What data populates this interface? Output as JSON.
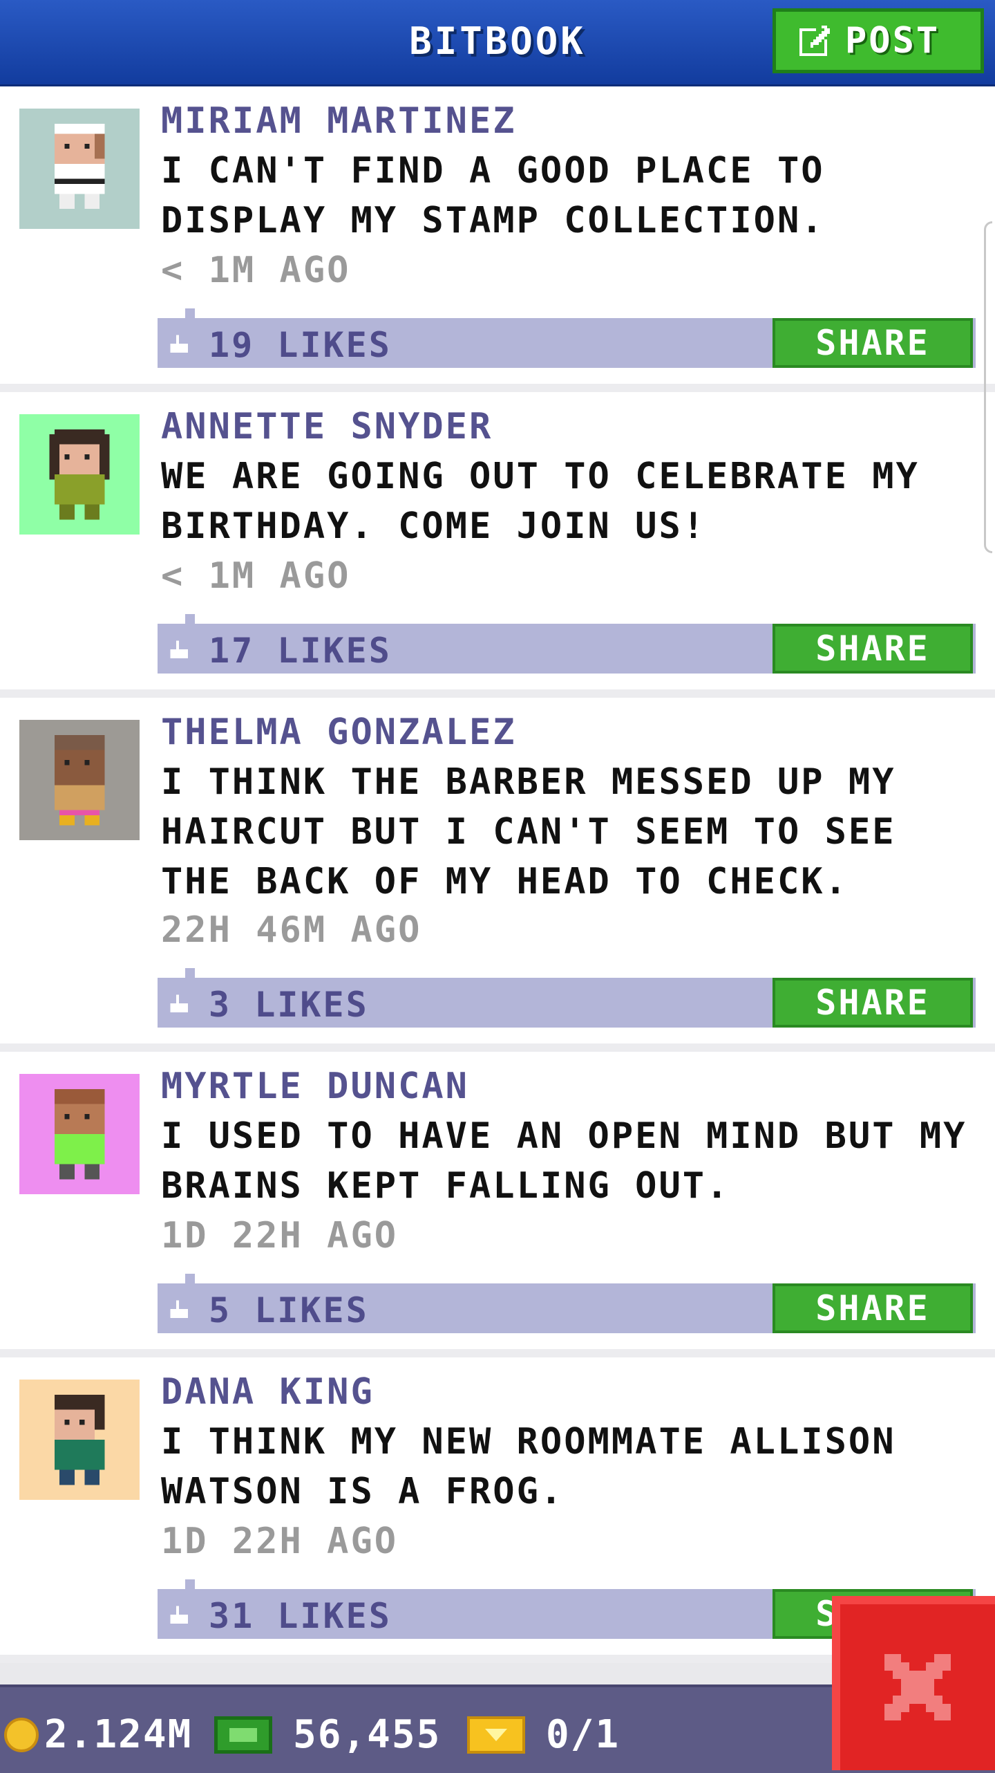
{
  "header": {
    "title": "BITBOOK",
    "post_label": "POST"
  },
  "posts": [
    {
      "name": "MIRIAM MARTINEZ",
      "message": "I CAN'T FIND A GOOD PLACE TO DISPLAY MY STAMP COLLECTION.",
      "time": "< 1M AGO",
      "likes": "19 LIKES",
      "share": "SHARE",
      "avatar_bg": "#b2cfc9"
    },
    {
      "name": "ANNETTE SNYDER",
      "message": "WE ARE GOING OUT TO CELEBRATE MY BIRTHDAY. COME JOIN US!",
      "time": "< 1M AGO",
      "likes": "17 LIKES",
      "share": "SHARE",
      "avatar_bg": "#8fffa6"
    },
    {
      "name": "THELMA GONZALEZ",
      "message": "I THINK THE BARBER MESSED UP MY HAIRCUT BUT I CAN'T SEEM TO SEE THE BACK OF MY HEAD TO CHECK.",
      "time": "22H 46M AGO",
      "likes": "3 LIKES",
      "share": "SHARE",
      "avatar_bg": "#9d9a95"
    },
    {
      "name": "MYRTLE DUNCAN",
      "message": "I USED TO HAVE AN OPEN MIND BUT MY BRAINS KEPT FALLING OUT.",
      "time": "1D 22H AGO",
      "likes": "5 LIKES",
      "share": "SHARE",
      "avatar_bg": "#ee8ef0"
    },
    {
      "name": "DANA KING",
      "message": "I THINK MY NEW ROOMMATE ALLISON WATSON IS A FROG.",
      "time": "1D 22H AGO",
      "likes": "31 LIKES",
      "share": "SHARE",
      "avatar_bg": "#fbd8a6"
    }
  ],
  "footer": {
    "coins": "2.124M",
    "bux": "56,455",
    "tickets": "0/1"
  },
  "icons": {
    "post": "edit-icon",
    "like": "thumbs-up-icon",
    "close": "close-icon",
    "coin": "coin-icon",
    "bux": "bux-icon",
    "ticket": "ticket-icon"
  }
}
